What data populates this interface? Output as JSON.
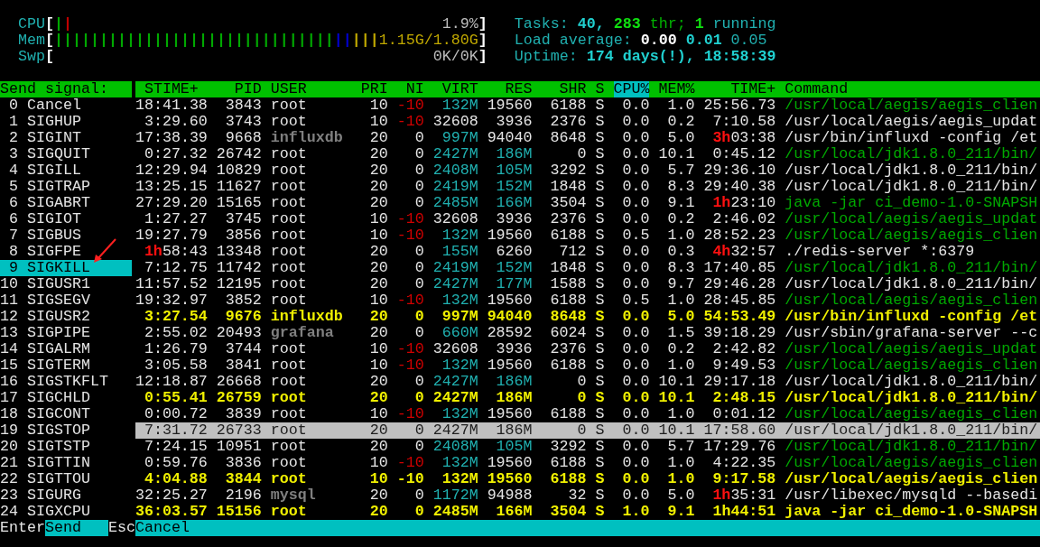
{
  "meters": [
    {
      "label": "CPU",
      "bracket_open": "[",
      "bracket_close": "]",
      "value": "1.9%",
      "segments": [
        {
          "text": "|",
          "color": "#00a800"
        },
        {
          "text": "|",
          "color": "#c00000"
        }
      ]
    },
    {
      "label": "Mem",
      "bracket_open": "[",
      "bracket_close": "]",
      "value": "1.15G/1.80G",
      "segments": [
        {
          "text": "|||||||||||||||||||||||||||||||",
          "color": "#00a800"
        },
        {
          "text": "||",
          "color": "#0000d0"
        },
        {
          "text": "|||",
          "color": "#c0a800"
        }
      ]
    },
    {
      "label": "Swp",
      "bracket_open": "[",
      "bracket_close": "]",
      "value": "0K/0K"
    }
  ],
  "summary": {
    "tasks": {
      "label": "Tasks:",
      "count": "40,",
      "threads": "283",
      "threads_label": "thr;",
      "running": "1",
      "running_label": "running"
    },
    "load": {
      "label": "Load average:",
      "values": [
        "0.00",
        "0.01",
        "0.05"
      ]
    },
    "uptime": {
      "label": "Uptime:",
      "value": "174 days(!), 18:58:39"
    }
  },
  "signal_panel": {
    "title": "Send signal:"
  },
  "columns": [
    {
      "label": "STIME+",
      "selected": false
    },
    {
      "label": "PID",
      "selected": false
    },
    {
      "label": "USER",
      "selected": false
    },
    {
      "label": "PRI",
      "selected": false
    },
    {
      "label": "NI",
      "selected": false
    },
    {
      "label": "VIRT",
      "selected": false
    },
    {
      "label": "RES",
      "selected": false
    },
    {
      "label": "SHR",
      "selected": false
    },
    {
      "label": "S",
      "selected": false
    },
    {
      "label": "CPU%",
      "selected": true
    },
    {
      "label": "MEM%",
      "selected": false
    },
    {
      "label": "TIME+",
      "selected": false
    },
    {
      "label": "Command",
      "selected": false
    }
  ],
  "signals": [
    {
      "number": "0",
      "name": "Cancel",
      "selected": false
    },
    {
      "number": "1",
      "name": "SIGHUP",
      "selected": false
    },
    {
      "number": "2",
      "name": "SIGINT",
      "selected": false
    },
    {
      "number": "3",
      "name": "SIGQUIT",
      "selected": false
    },
    {
      "number": "4",
      "name": "SIGILL",
      "selected": false
    },
    {
      "number": "5",
      "name": "SIGTRAP",
      "selected": false
    },
    {
      "number": "6",
      "name": "SIGABRT",
      "selected": false
    },
    {
      "number": "6",
      "name": "SIGIOT",
      "selected": false
    },
    {
      "number": "7",
      "name": "SIGBUS",
      "selected": false
    },
    {
      "number": "8",
      "name": "SIGFPE",
      "selected": false
    },
    {
      "number": "9",
      "name": "SIGKILL",
      "selected": true
    },
    {
      "number": "10",
      "name": "SIGUSR1",
      "selected": false
    },
    {
      "number": "11",
      "name": "SIGSEGV",
      "selected": false
    },
    {
      "number": "12",
      "name": "SIGUSR2",
      "selected": false
    },
    {
      "number": "13",
      "name": "SIGPIPE",
      "selected": false
    },
    {
      "number": "14",
      "name": "SIGALRM",
      "selected": false
    },
    {
      "number": "15",
      "name": "SIGTERM",
      "selected": false
    },
    {
      "number": "16",
      "name": "SIGSTKFLT",
      "selected": false
    },
    {
      "number": "17",
      "name": "SIGCHLD",
      "selected": false
    },
    {
      "number": "18",
      "name": "SIGCONT",
      "selected": false
    },
    {
      "number": "19",
      "name": "SIGSTOP",
      "selected": false
    },
    {
      "number": "20",
      "name": "SIGTSTP",
      "selected": false
    },
    {
      "number": "21",
      "name": "SIGTTIN",
      "selected": false
    },
    {
      "number": "22",
      "name": "SIGTTOU",
      "selected": false
    },
    {
      "number": "23",
      "name": "SIGURG",
      "selected": false
    },
    {
      "number": "24",
      "name": "SIGXCPU",
      "selected": false
    }
  ],
  "processes": [
    {
      "stime": "18:41.38",
      "pid": "3843",
      "user": "root",
      "pri": "10",
      "ni": "-10",
      "virt": "132M",
      "res": "19560",
      "shr": "6188",
      "s": "S",
      "cpu": "0.0",
      "mem": "1.0",
      "time": "25:56.73",
      "command": "/usr/local/aegis/aegis_clien",
      "kind": "thread",
      "tagged": false,
      "selected": false,
      "dimmed_user": false
    },
    {
      "stime": "3:29.60",
      "pid": "3743",
      "user": "root",
      "pri": "10",
      "ni": "-10",
      "virt": "32608",
      "res": "3936",
      "shr": "2376",
      "s": "S",
      "cpu": "0.0",
      "mem": "0.2",
      "time": "7:10.58",
      "command": "/usr/local/aegis/aegis_updat",
      "kind": "process",
      "tagged": false,
      "selected": false,
      "dimmed_user": false
    },
    {
      "stime": "17:38.39",
      "pid": "9668",
      "user": "influxdb",
      "pri": "20",
      "ni": "0",
      "virt": "997M",
      "res": "94040",
      "shr": "8648",
      "s": "S",
      "cpu": "0.0",
      "mem": "5.0",
      "time": "3h03:38",
      "command": "/usr/bin/influxd -config /et",
      "kind": "process",
      "tagged": false,
      "selected": false,
      "dimmed_user": true
    },
    {
      "stime": "0:27.32",
      "pid": "26742",
      "user": "root",
      "pri": "20",
      "ni": "0",
      "virt": "2427M",
      "res": "186M",
      "shr": "0",
      "s": "S",
      "cpu": "0.0",
      "mem": "10.1",
      "time": "0:45.12",
      "command": "/usr/local/jdk1.8.0_211/bin/",
      "kind": "thread",
      "tagged": false,
      "selected": false,
      "dimmed_user": false
    },
    {
      "stime": "12:29.94",
      "pid": "10829",
      "user": "root",
      "pri": "20",
      "ni": "0",
      "virt": "2408M",
      "res": "105M",
      "shr": "3292",
      "s": "S",
      "cpu": "0.0",
      "mem": "5.7",
      "time": "29:36.10",
      "command": "/usr/local/jdk1.8.0_211/bin/",
      "kind": "process",
      "tagged": false,
      "selected": false,
      "dimmed_user": false
    },
    {
      "stime": "13:25.15",
      "pid": "11627",
      "user": "root",
      "pri": "20",
      "ni": "0",
      "virt": "2419M",
      "res": "152M",
      "shr": "1848",
      "s": "S",
      "cpu": "0.0",
      "mem": "8.3",
      "time": "29:40.38",
      "command": "/usr/local/jdk1.8.0_211/bin/",
      "kind": "process",
      "tagged": false,
      "selected": false,
      "dimmed_user": false
    },
    {
      "stime": "27:29.20",
      "pid": "15165",
      "user": "root",
      "pri": "20",
      "ni": "0",
      "virt": "2485M",
      "res": "166M",
      "shr": "3504",
      "s": "S",
      "cpu": "0.0",
      "mem": "9.1",
      "time": "1h23:10",
      "command": "java -jar ci_demo-1.0-SNAPSH",
      "kind": "thread",
      "tagged": false,
      "selected": false,
      "dimmed_user": false
    },
    {
      "stime": "1:27.27",
      "pid": "3745",
      "user": "root",
      "pri": "10",
      "ni": "-10",
      "virt": "32608",
      "res": "3936",
      "shr": "2376",
      "s": "S",
      "cpu": "0.0",
      "mem": "0.2",
      "time": "2:46.02",
      "command": "/usr/local/aegis/aegis_updat",
      "kind": "thread",
      "tagged": false,
      "selected": false,
      "dimmed_user": false
    },
    {
      "stime": "19:27.79",
      "pid": "3856",
      "user": "root",
      "pri": "10",
      "ni": "-10",
      "virt": "132M",
      "res": "19560",
      "shr": "6188",
      "s": "S",
      "cpu": "0.5",
      "mem": "1.0",
      "time": "28:52.23",
      "command": "/usr/local/aegis/aegis_clien",
      "kind": "thread",
      "tagged": false,
      "selected": false,
      "dimmed_user": false
    },
    {
      "stime": "1h58:43",
      "pid": "13348",
      "user": "root",
      "pri": "20",
      "ni": "0",
      "virt": "155M",
      "res": "6260",
      "shr": "712",
      "s": "S",
      "cpu": "0.0",
      "mem": "0.3",
      "time": "4h32:57",
      "command": "./redis-server *:6379",
      "kind": "process",
      "tagged": false,
      "selected": false,
      "dimmed_user": false
    },
    {
      "stime": "7:12.75",
      "pid": "11742",
      "user": "root",
      "pri": "20",
      "ni": "0",
      "virt": "2419M",
      "res": "152M",
      "shr": "1848",
      "s": "S",
      "cpu": "0.0",
      "mem": "8.3",
      "time": "17:40.85",
      "command": "/usr/local/jdk1.8.0_211/bin/",
      "kind": "thread",
      "tagged": false,
      "selected": false,
      "dimmed_user": false
    },
    {
      "stime": "11:57.52",
      "pid": "12195",
      "user": "root",
      "pri": "20",
      "ni": "0",
      "virt": "2427M",
      "res": "177M",
      "shr": "1588",
      "s": "S",
      "cpu": "0.0",
      "mem": "9.7",
      "time": "29:46.28",
      "command": "/usr/local/jdk1.8.0_211/bin/",
      "kind": "process",
      "tagged": false,
      "selected": false,
      "dimmed_user": false
    },
    {
      "stime": "19:32.97",
      "pid": "3852",
      "user": "root",
      "pri": "10",
      "ni": "-10",
      "virt": "132M",
      "res": "19560",
      "shr": "6188",
      "s": "S",
      "cpu": "0.5",
      "mem": "1.0",
      "time": "28:45.85",
      "command": "/usr/local/aegis/aegis_clien",
      "kind": "thread",
      "tagged": false,
      "selected": false,
      "dimmed_user": false
    },
    {
      "stime": "3:27.54",
      "pid": "9676",
      "user": "influxdb",
      "pri": "20",
      "ni": "0",
      "virt": "997M",
      "res": "94040",
      "shr": "8648",
      "s": "S",
      "cpu": "0.0",
      "mem": "5.0",
      "time": "54:53.49",
      "command": "/usr/bin/influxd -config /et",
      "kind": "process",
      "tagged": true,
      "selected": false,
      "dimmed_user": false
    },
    {
      "stime": "2:55.02",
      "pid": "20493",
      "user": "grafana",
      "pri": "20",
      "ni": "0",
      "virt": "660M",
      "res": "28592",
      "shr": "6024",
      "s": "S",
      "cpu": "0.0",
      "mem": "1.5",
      "time": "39:18.29",
      "command": "/usr/sbin/grafana-server --c",
      "kind": "process",
      "tagged": false,
      "selected": false,
      "dimmed_user": true
    },
    {
      "stime": "1:26.79",
      "pid": "3744",
      "user": "root",
      "pri": "10",
      "ni": "-10",
      "virt": "32608",
      "res": "3936",
      "shr": "2376",
      "s": "S",
      "cpu": "0.0",
      "mem": "0.2",
      "time": "2:42.82",
      "command": "/usr/local/aegis/aegis_updat",
      "kind": "thread",
      "tagged": false,
      "selected": false,
      "dimmed_user": false
    },
    {
      "stime": "3:05.58",
      "pid": "3841",
      "user": "root",
      "pri": "10",
      "ni": "-10",
      "virt": "132M",
      "res": "19560",
      "shr": "6188",
      "s": "S",
      "cpu": "0.0",
      "mem": "1.0",
      "time": "9:49.53",
      "command": "/usr/local/aegis/aegis_clien",
      "kind": "thread",
      "tagged": false,
      "selected": false,
      "dimmed_user": false
    },
    {
      "stime": "12:18.87",
      "pid": "26668",
      "user": "root",
      "pri": "20",
      "ni": "0",
      "virt": "2427M",
      "res": "186M",
      "shr": "0",
      "s": "S",
      "cpu": "0.0",
      "mem": "10.1",
      "time": "29:17.18",
      "command": "/usr/local/jdk1.8.0_211/bin/",
      "kind": "process",
      "tagged": false,
      "selected": false,
      "dimmed_user": false
    },
    {
      "stime": "0:55.41",
      "pid": "26759",
      "user": "root",
      "pri": "20",
      "ni": "0",
      "virt": "2427M",
      "res": "186M",
      "shr": "0",
      "s": "S",
      "cpu": "0.0",
      "mem": "10.1",
      "time": "2:48.15",
      "command": "/usr/local/jdk1.8.0_211/bin/",
      "kind": "process",
      "tagged": true,
      "selected": false,
      "dimmed_user": false
    },
    {
      "stime": "0:00.72",
      "pid": "3839",
      "user": "root",
      "pri": "10",
      "ni": "-10",
      "virt": "132M",
      "res": "19560",
      "shr": "6188",
      "s": "S",
      "cpu": "0.0",
      "mem": "1.0",
      "time": "0:01.12",
      "command": "/usr/local/aegis/aegis_clien",
      "kind": "thread",
      "tagged": false,
      "selected": false,
      "dimmed_user": false
    },
    {
      "stime": "7:31.72",
      "pid": "26733",
      "user": "root",
      "pri": "20",
      "ni": "0",
      "virt": "2427M",
      "res": "186M",
      "shr": "0",
      "s": "S",
      "cpu": "0.0",
      "mem": "10.1",
      "time": "17:58.60",
      "command": "/usr/local/jdk1.8.0_211/bin/",
      "kind": "process",
      "tagged": false,
      "selected": true,
      "dimmed_user": false
    },
    {
      "stime": "7:24.15",
      "pid": "10951",
      "user": "root",
      "pri": "20",
      "ni": "0",
      "virt": "2408M",
      "res": "105M",
      "shr": "3292",
      "s": "S",
      "cpu": "0.0",
      "mem": "5.7",
      "time": "17:29.76",
      "command": "/usr/local/jdk1.8.0_211/bin/",
      "kind": "thread",
      "tagged": false,
      "selected": false,
      "dimmed_user": false
    },
    {
      "stime": "0:59.76",
      "pid": "3836",
      "user": "root",
      "pri": "10",
      "ni": "-10",
      "virt": "132M",
      "res": "19560",
      "shr": "6188",
      "s": "S",
      "cpu": "0.0",
      "mem": "1.0",
      "time": "4:22.35",
      "command": "/usr/local/aegis/aegis_clien",
      "kind": "thread",
      "tagged": false,
      "selected": false,
      "dimmed_user": false
    },
    {
      "stime": "4:04.88",
      "pid": "3844",
      "user": "root",
      "pri": "10",
      "ni": "-10",
      "virt": "132M",
      "res": "19560",
      "shr": "6188",
      "s": "S",
      "cpu": "0.0",
      "mem": "1.0",
      "time": "9:17.58",
      "command": "/usr/local/aegis/aegis_clien",
      "kind": "process",
      "tagged": true,
      "selected": false,
      "dimmed_user": false
    },
    {
      "stime": "32:25.27",
      "pid": "2196",
      "user": "mysql",
      "pri": "20",
      "ni": "0",
      "virt": "1172M",
      "res": "94988",
      "shr": "32",
      "s": "S",
      "cpu": "0.0",
      "mem": "5.0",
      "time": "1h35:31",
      "command": "/usr/libexec/mysqld --basedi",
      "kind": "process",
      "tagged": false,
      "selected": false,
      "dimmed_user": true
    },
    {
      "stime": "36:03.57",
      "pid": "15156",
      "user": "root",
      "pri": "20",
      "ni": "0",
      "virt": "2485M",
      "res": "166M",
      "shr": "3504",
      "s": "S",
      "cpu": "1.0",
      "mem": "9.1",
      "time": "1h44:51",
      "command": "java -jar ci_demo-1.0-SNAPSH",
      "kind": "process",
      "tagged": true,
      "selected": false,
      "dimmed_user": false
    }
  ],
  "footer": [
    {
      "key": "Enter",
      "label": "Send"
    },
    {
      "key": "Esc",
      "label": "Cancel"
    }
  ]
}
